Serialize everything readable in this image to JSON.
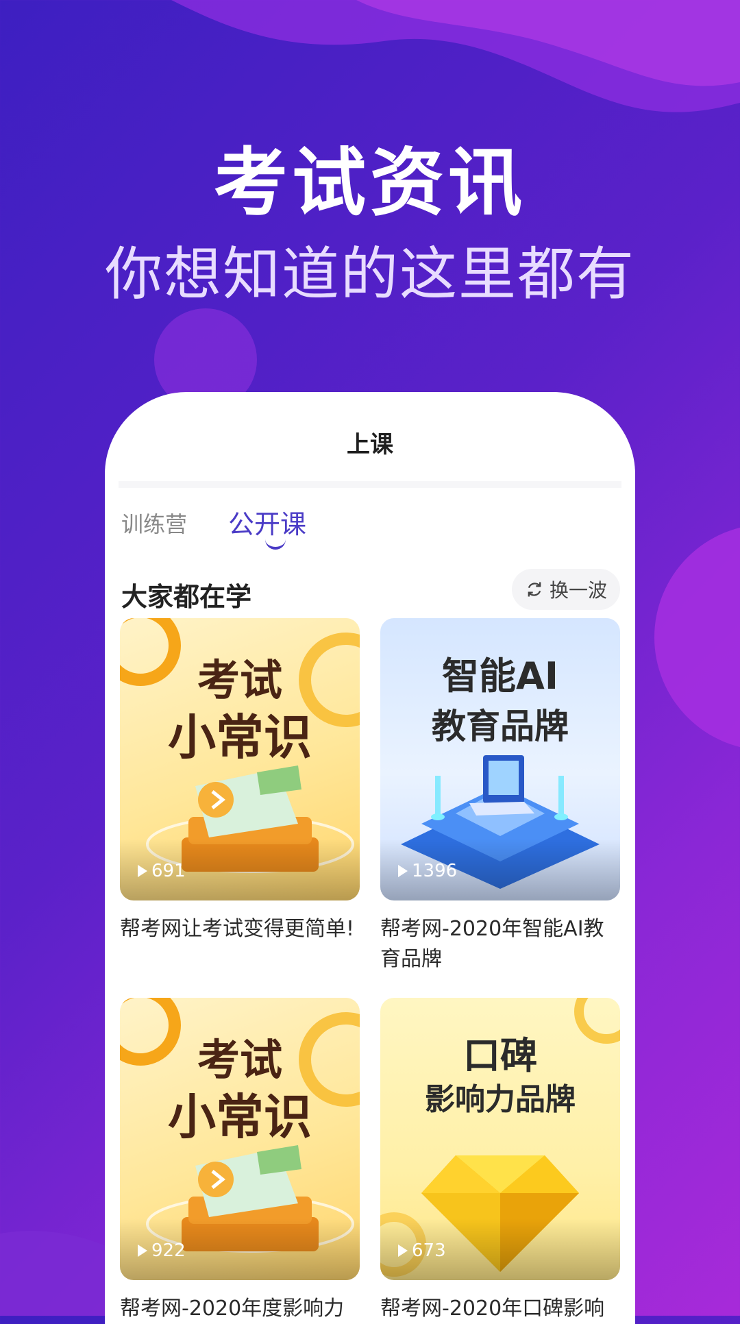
{
  "hero": {
    "title": "考试资讯",
    "subtitle": "你想知道的这里都有"
  },
  "phone": {
    "header_title": "上课",
    "tabs": [
      {
        "label": "训练营",
        "active": false
      },
      {
        "label": "公开课",
        "active": true
      }
    ],
    "section_title": "大家都在学",
    "refresh_label": "换一波",
    "cards": [
      {
        "thumb_line1": "考试",
        "thumb_line2": "小常识",
        "play_count": "691",
        "title": "帮考网让考试变得更简单!"
      },
      {
        "thumb_line1": "智能AI",
        "thumb_line2": "教育品牌",
        "play_count": "1396",
        "title": "帮考网-2020年智能AI教育品牌"
      },
      {
        "thumb_line1": "考试",
        "thumb_line2": "小常识",
        "play_count": "922",
        "title": "帮考网-2020年度影响力"
      },
      {
        "thumb_line1": "口碑",
        "thumb_line2": "影响力品牌",
        "play_count": "673",
        "title": "帮考网-2020年口碑影响"
      }
    ]
  },
  "colors": {
    "accent": "#4a3bc6",
    "bg_start": "#3d1fc1",
    "bg_end": "#a72ad9"
  }
}
